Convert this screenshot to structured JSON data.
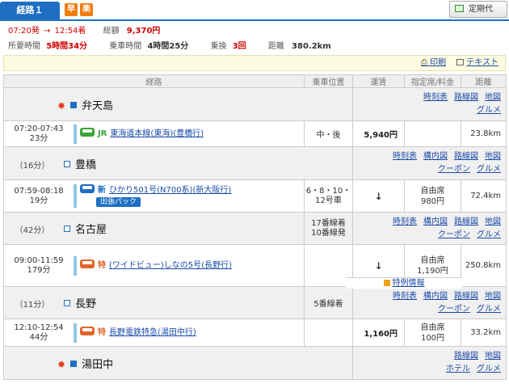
{
  "tabs": {
    "route": "経路１",
    "badge1": "早",
    "badge2": "楽"
  },
  "teiki_label": "定期代",
  "summary": {
    "depart": "07:20発",
    "arrow": "→",
    "arrive": "12:54着",
    "total_fare_label": "総額",
    "total_fare": "9,370円",
    "required_time_label": "所要時間",
    "required_time": "5時間34分",
    "ride_time_label": "乗車時間",
    "ride_time": "4時間25分",
    "transfer_label": "乗換",
    "transfer": "3回",
    "distance_label": "距離",
    "distance": "380.2km"
  },
  "print_label": "印刷",
  "text_label": "テキスト",
  "headers": [
    "経路",
    "乗車位置",
    "運賃",
    "指定席/料金",
    "距離"
  ],
  "stations": [
    {
      "wait": "",
      "name": "弁天島",
      "links1": [
        "時刻表",
        "路線図",
        "地図"
      ],
      "links2": [
        "グルメ"
      ]
    },
    {
      "wait": "（16分）",
      "name": "豊橋",
      "links1": [
        "時刻表",
        "構内図",
        "路線図",
        "地図"
      ],
      "links2": [
        "クーポン",
        "グルメ"
      ]
    },
    {
      "wait": "（42分）",
      "name": "名古屋",
      "platform1": "17番線着",
      "platform2": "10番線発",
      "links1": [
        "時刻表",
        "構内図",
        "路線図",
        "地図"
      ],
      "links2": [
        "クーポン",
        "グルメ"
      ]
    },
    {
      "wait": "（11分）",
      "name": "長野",
      "platform1": "5番線着",
      "links1": [
        "時刻表",
        "構内図",
        "路線図",
        "地図"
      ],
      "links2": [
        "クーポン",
        "グルメ"
      ]
    },
    {
      "wait": "",
      "name": "湯田中",
      "links1": [
        "路線図",
        "地図"
      ],
      "links2": [
        "ホテル",
        "グルメ"
      ]
    }
  ],
  "segments": [
    {
      "time": "07:20-07:43",
      "dur": "23分",
      "tag": "JR",
      "line_name": "東海道本線(東海)(豊橋行)",
      "position": "中・後",
      "fare": "5,940円",
      "seat": "",
      "seat_fare": "",
      "dist": "23.8km",
      "color": "#3aa335"
    },
    {
      "time": "07:59-08:18",
      "dur": "19分",
      "tag": "新",
      "line_name": "ひかり501号(N700系)(新大阪行)",
      "position": "6・8・10・12号車",
      "fare": "↓",
      "seat": "自由席",
      "seat_fare": "980円",
      "dist": "72.4km",
      "badge": "出張パック",
      "color": "#1e6fc4"
    },
    {
      "time": "09:00-11:59",
      "dur": "179分",
      "tag": "特",
      "line_name": "(ワイドビュー)しなの5号(長野行)",
      "position": "",
      "fare": "↓",
      "seat": "自由席",
      "seat_fare": "1,190円",
      "dist": "250.8km",
      "extra": "特例情報",
      "color": "#e0672a"
    },
    {
      "time": "12:10-12:54",
      "dur": "44分",
      "tag": "特",
      "line_name": "長野電鉄特急(湯田中行)",
      "position": "",
      "fare": "1,160円",
      "seat": "自由席",
      "seat_fare": "100円",
      "dist": "33.2km",
      "color": "#e0672a"
    }
  ]
}
